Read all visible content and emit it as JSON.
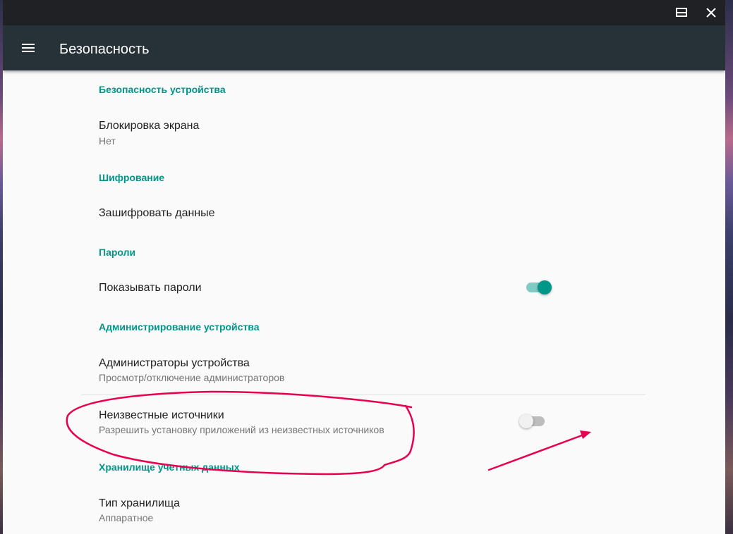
{
  "window": {
    "title_bar": {
      "maximize_icon": "maximize-icon",
      "close_icon": "close-icon"
    }
  },
  "app_bar": {
    "menu_icon": "hamburger-menu-icon",
    "title": "Безопасность"
  },
  "sections": [
    {
      "header": "Безопасность устройства",
      "items": [
        {
          "title": "Блокировка экрана",
          "summary": "Нет"
        }
      ]
    },
    {
      "header": "Шифрование",
      "items": [
        {
          "title": "Зашифровать данные"
        }
      ]
    },
    {
      "header": "Пароли",
      "items": [
        {
          "title": "Показывать пароли",
          "switch_on": true
        }
      ]
    },
    {
      "header": "Администрирование устройства",
      "items": [
        {
          "title": "Администраторы устройства",
          "summary": "Просмотр/отключение администраторов"
        },
        {
          "title": "Неизвестные источники",
          "summary": "Разрешить установку приложений из неизвестных источников",
          "switch_on": false
        }
      ]
    },
    {
      "header": "Хранилище учетных данных",
      "items": [
        {
          "title": "Тип хранилища",
          "summary": "Аппаратное"
        }
      ]
    }
  ],
  "colors": {
    "accent": "#009688",
    "app_bar": "#263238",
    "title_bar": "#202124",
    "annotation": "#e8004f"
  }
}
